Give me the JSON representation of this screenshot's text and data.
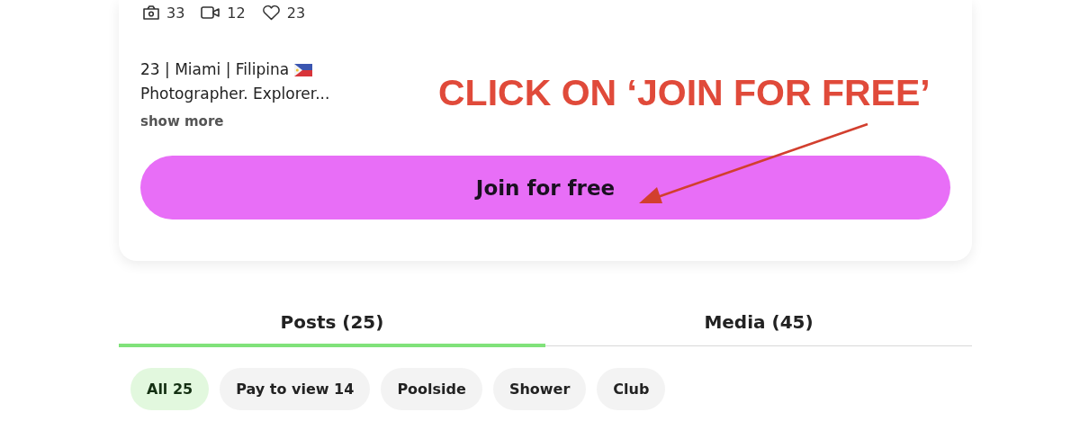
{
  "stats": [
    {
      "kind": "photos",
      "count": "33"
    },
    {
      "kind": "videos",
      "count": "12"
    },
    {
      "kind": "likes",
      "count": "23"
    }
  ],
  "bio": {
    "lines": [
      "23 | Miami | Filipina",
      "Photographer. Explorer..."
    ],
    "show_more": "show more"
  },
  "join_button": "Join for free",
  "annotation": {
    "text": "CLICK ON ‘JOIN FOR FREE’"
  },
  "tabs": [
    {
      "label": "Posts (25)",
      "selected": true
    },
    {
      "label": "Media (45)",
      "selected": false
    }
  ],
  "filters": [
    {
      "label": "All 25",
      "selected": true
    },
    {
      "label": "Pay to view 14",
      "selected": false
    },
    {
      "label": "Poolside",
      "selected": false
    },
    {
      "label": "Shower",
      "selected": false
    },
    {
      "label": "Club",
      "selected": false
    }
  ]
}
